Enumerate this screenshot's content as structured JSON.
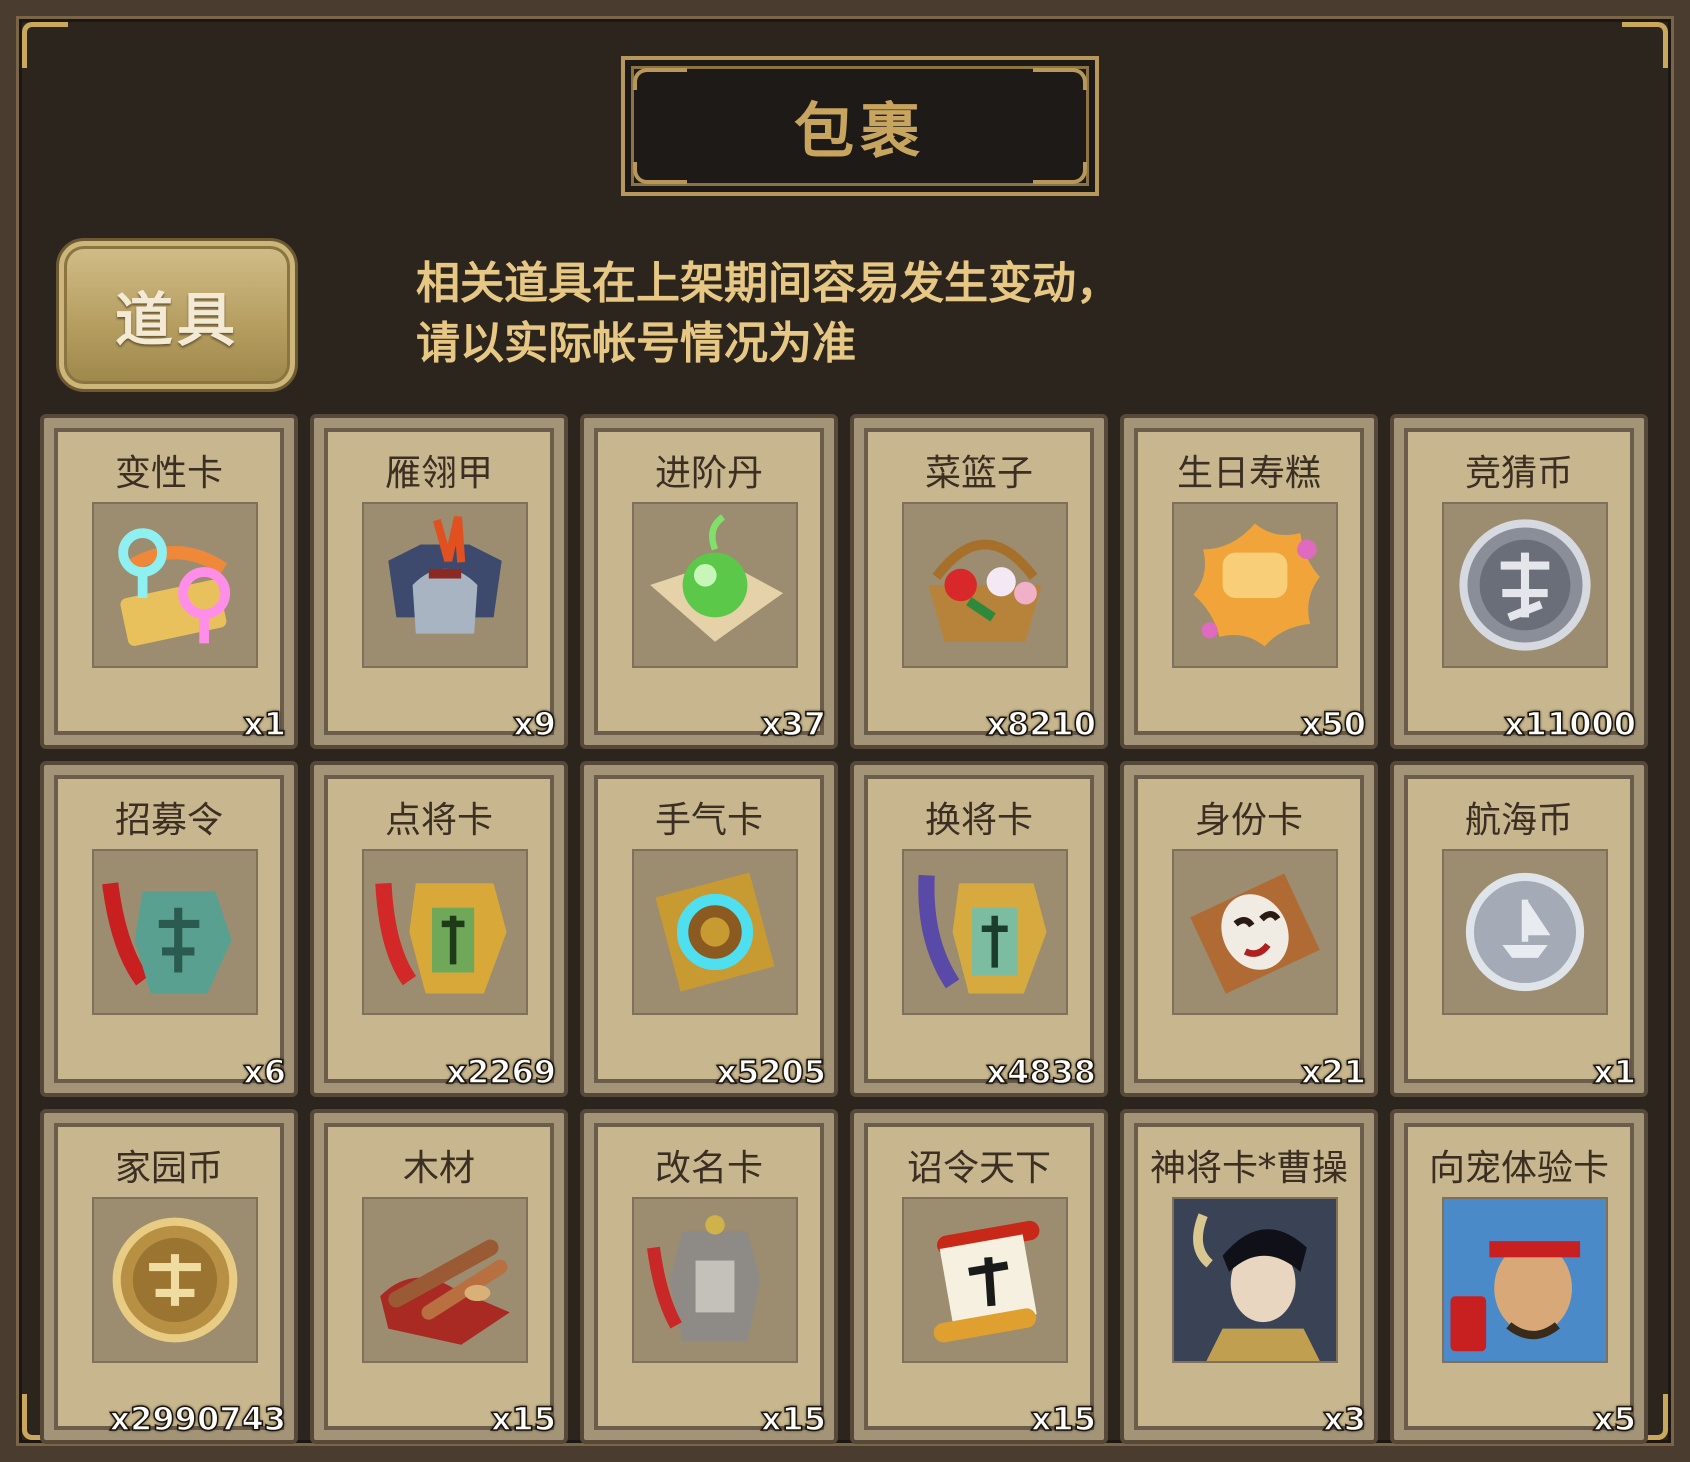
{
  "header": {
    "title": "包裹"
  },
  "tabs": [
    {
      "label": "道具",
      "active": true
    }
  ],
  "notice": {
    "line1": "相关道具在上架期间容易发生变动，",
    "line2": "请以实际帐号情况为准"
  },
  "items": [
    {
      "name": "变性卡",
      "count": "x1",
      "icon": "gender-swap-icon"
    },
    {
      "name": "雁翎甲",
      "count": "x9",
      "icon": "armor-icon"
    },
    {
      "name": "进阶丹",
      "count": "x37",
      "icon": "green-pill-icon"
    },
    {
      "name": "菜篮子",
      "count": "x8210",
      "icon": "flower-basket-icon"
    },
    {
      "name": "生日寿糕",
      "count": "x50",
      "icon": "birthday-cake-icon"
    },
    {
      "name": "竞猜币",
      "count": "x11000",
      "icon": "silver-coin-icon"
    },
    {
      "name": "招募令",
      "count": "x6",
      "icon": "recruit-token-icon"
    },
    {
      "name": "点将卡",
      "count": "x2269",
      "icon": "general-token-icon"
    },
    {
      "name": "手气卡",
      "count": "x5205",
      "icon": "luck-card-icon"
    },
    {
      "name": "换将卡",
      "count": "x4838",
      "icon": "swap-general-token-icon"
    },
    {
      "name": "身份卡",
      "count": "x21",
      "icon": "mask-card-icon"
    },
    {
      "name": "航海币",
      "count": "x1",
      "icon": "ship-coin-icon"
    },
    {
      "name": "家园币",
      "count": "x2990743",
      "icon": "home-coin-icon"
    },
    {
      "name": "木材",
      "count": "x15",
      "icon": "wood-icon"
    },
    {
      "name": "改名卡",
      "count": "x15",
      "icon": "rename-tag-icon"
    },
    {
      "name": "诏令天下",
      "count": "x15",
      "icon": "edict-scroll-icon"
    },
    {
      "name": "神将卡*曹操",
      "count": "x3",
      "icon": "general-portrait-icon"
    },
    {
      "name": "向宠体验卡",
      "count": "x5",
      "icon": "trial-portrait-icon"
    }
  ],
  "colors": {
    "background": "#2c251e",
    "gold": "#c8a55e",
    "notice": "#e6c784",
    "card": "#c8b78e"
  }
}
